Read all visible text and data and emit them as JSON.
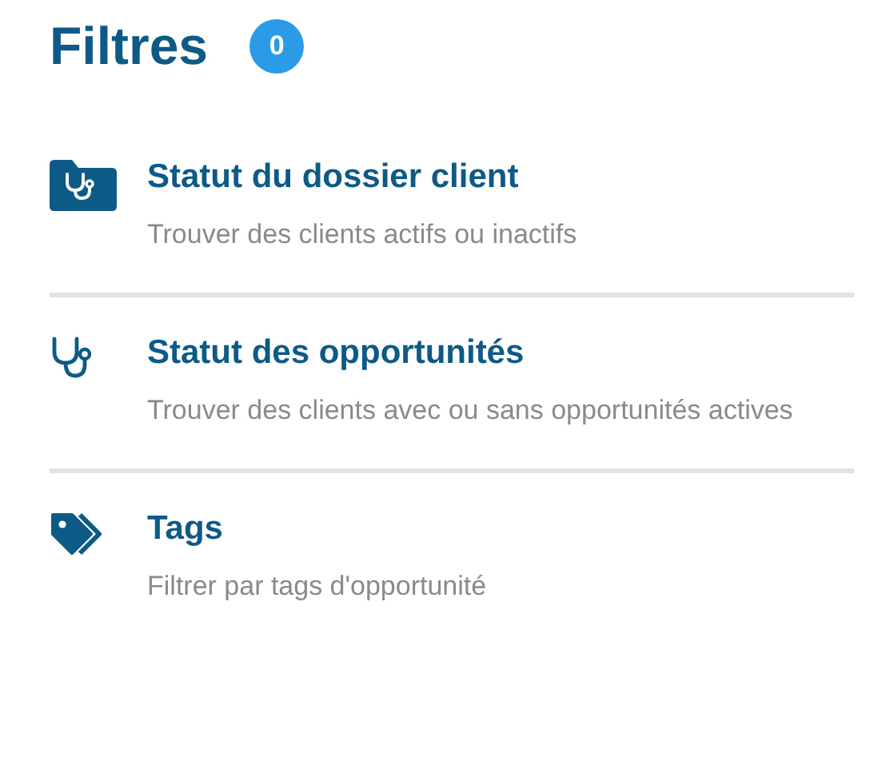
{
  "header": {
    "title": "Filtres",
    "count": "0"
  },
  "filters": [
    {
      "kind": "folder",
      "title": "Statut du dossier client",
      "description": "Trouver des clients actifs ou inactifs"
    },
    {
      "kind": "stethoscope",
      "title": "Statut des opportunités",
      "description": "Trouver des clients avec ou sans opportunités actives"
    },
    {
      "kind": "tags",
      "title": "Tags",
      "description": "Filtrer par tags d'opportunité"
    }
  ]
}
